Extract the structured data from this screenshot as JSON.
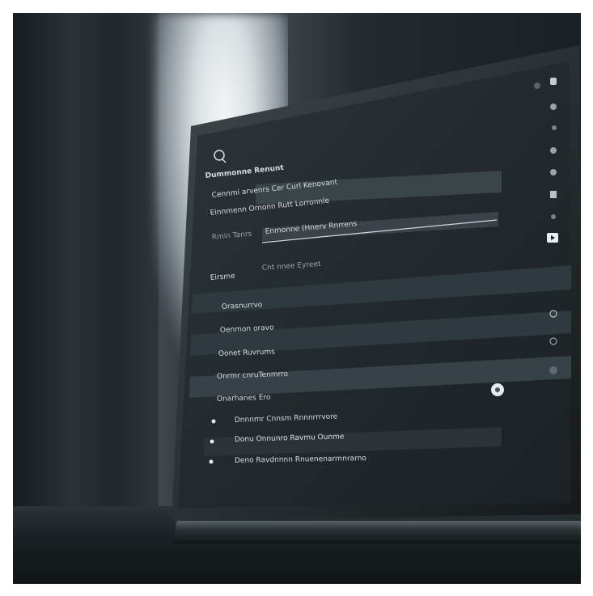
{
  "screen": {
    "header_line": "Dummonne Renunt",
    "row_1": "Cennmi arvenrs Cer Curl Kenovant",
    "row_2": "Einnmenn Ornonn Rutt Lorronnle",
    "label_a": "Rmin Tanrs",
    "field_value": "Enmonne (Hnerv Rnrrens",
    "field_2": "Cnt nnee Eyreet",
    "side_label": "Eirsme",
    "list": [
      "Orasnurrvo",
      "Oenmon oravo",
      "Oonet Ruvrums",
      "Onrmr cnruTenmrro",
      "Onarhanes Ero"
    ],
    "footer_rows": [
      "Dnnnmr Cnnsm Rnnnrrrvore",
      "Donu Onnunro Ravmu Ounme",
      "Deno Ravdnnnn Rnuenenarrnnrarno"
    ]
  },
  "icons": [
    "search-icon",
    "bell-icon",
    "circle-icon",
    "settings-icon",
    "toggle-icon",
    "play-icon",
    "key-icon"
  ]
}
